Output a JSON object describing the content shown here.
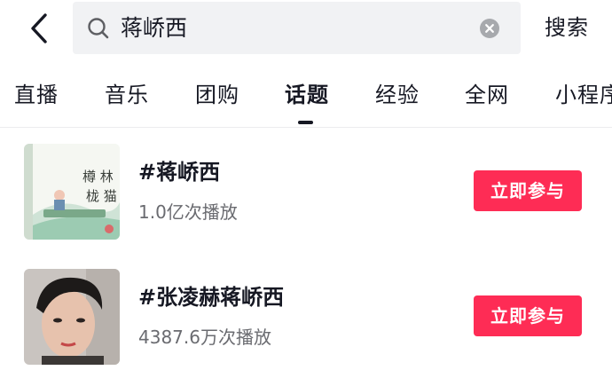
{
  "colors": {
    "accent": "#fe2c55",
    "search_bg": "#f1f2f4",
    "text_primary": "#161823",
    "text_secondary": "#6a6b70"
  },
  "header": {
    "back_icon": "chevron-left-icon",
    "search": {
      "icon": "search-icon",
      "value": "蒋峤西",
      "clear_icon": "clear-circle-icon"
    },
    "search_button_label": "搜索"
  },
  "tabs": [
    {
      "label": "直播",
      "active": false
    },
    {
      "label": "音乐",
      "active": false
    },
    {
      "label": "团购",
      "active": false
    },
    {
      "label": "话题",
      "active": true
    },
    {
      "label": "经验",
      "active": false
    },
    {
      "label": "全网",
      "active": false
    },
    {
      "label": "小程序",
      "active": false
    }
  ],
  "topics": [
    {
      "title": "#蒋峤西",
      "plays": "1.0亿次播放",
      "button_label": "立即参与",
      "thumbnail": "book-cover-thumbnail"
    },
    {
      "title": "#张凌赫蒋峤西",
      "plays": "4387.6万次播放",
      "button_label": "立即参与",
      "thumbnail": "actor-portrait-thumbnail"
    }
  ]
}
